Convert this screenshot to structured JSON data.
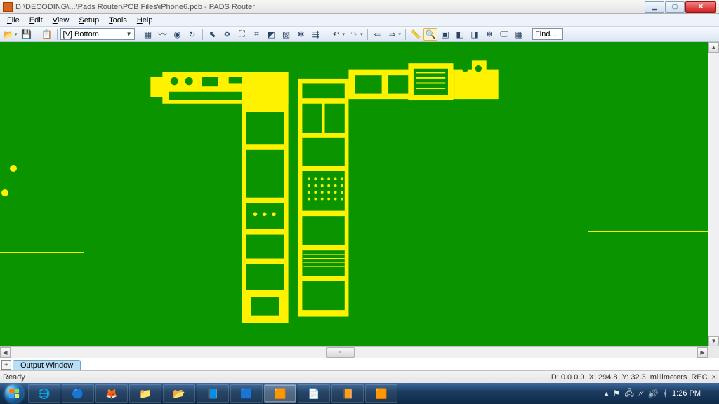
{
  "window": {
    "title": "D:\\DECODING\\...\\Pads Router\\PCB Files\\iPhone6.pcb - PADS Router",
    "min_label": "Minimize",
    "max_label": "Maximize",
    "close_label": "Close"
  },
  "menu": {
    "items": [
      {
        "label": "File",
        "key": "F"
      },
      {
        "label": "Edit",
        "key": "E"
      },
      {
        "label": "View",
        "key": "V"
      },
      {
        "label": "Setup",
        "key": "S"
      },
      {
        "label": "Tools",
        "key": "T"
      },
      {
        "label": "Help",
        "key": "H"
      }
    ]
  },
  "toolbar": {
    "open_icon": "open",
    "save_icon": "save",
    "undo_icon": "undo",
    "redo_icon": "redo",
    "layer_selected": "[V] Bottom",
    "find_label": "Find...",
    "zoom_active": true
  },
  "canvas": {
    "bg_color": "#0a9400",
    "layer_color": "#fff200"
  },
  "output_tab": "Output Window",
  "status": {
    "ready": "Ready",
    "d": "D: 0.0 0.0",
    "x": "X: 294.8",
    "y": "Y: 32.3",
    "units": "millimeters",
    "rec": "REC",
    "inc": "×"
  },
  "taskbar": {
    "time": "1:26 PM",
    "apps": [
      "chrome",
      "skype",
      "firefox",
      "explorer",
      "folder",
      "app-pads",
      "app-tm",
      "app-viewer",
      "app-pcb",
      "app-viewer2",
      "app-g"
    ]
  }
}
